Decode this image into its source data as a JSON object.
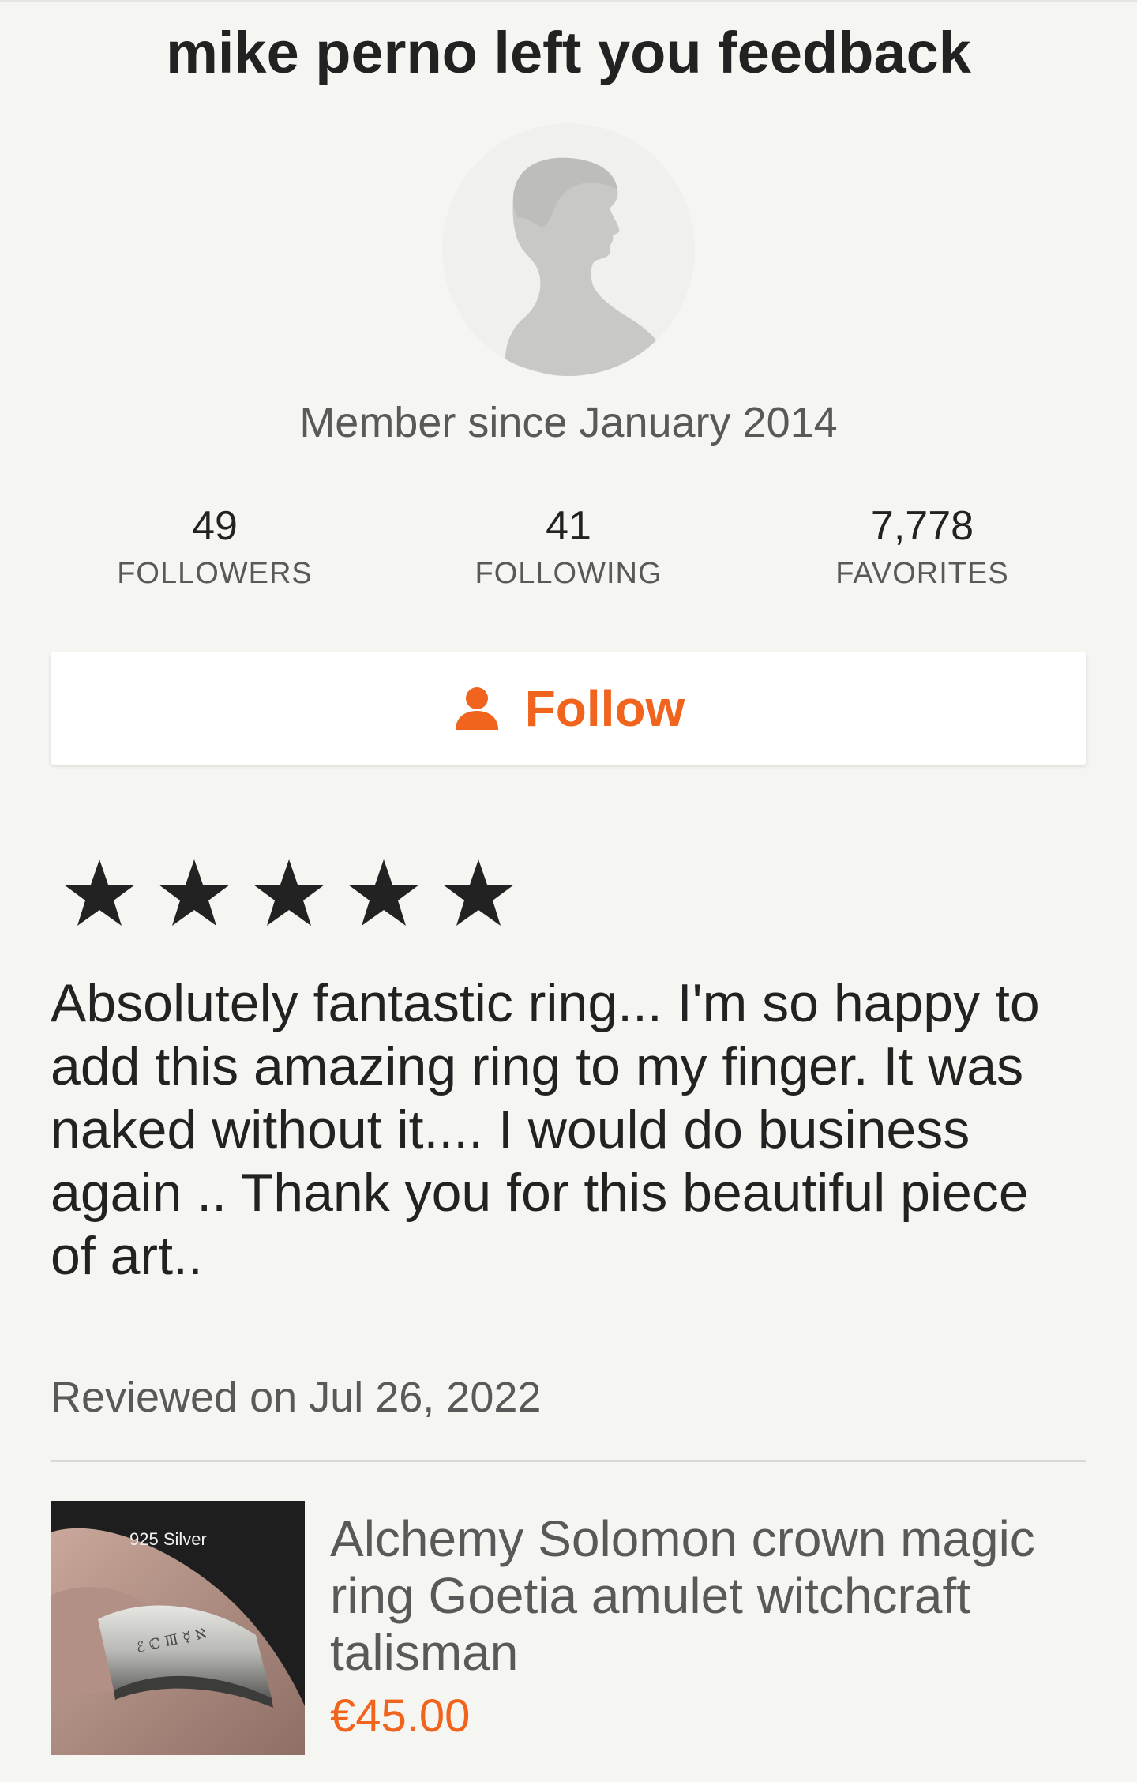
{
  "header": {
    "title": "mike perno left you feedback"
  },
  "profile": {
    "member_since": "Member since January 2014",
    "stats": [
      {
        "value": "49",
        "label": "FOLLOWERS"
      },
      {
        "value": "41",
        "label": "FOLLOWING"
      },
      {
        "value": "7,778",
        "label": "FAVORITES"
      }
    ],
    "follow_label": "Follow"
  },
  "review": {
    "rating": 5,
    "rating_max": 5,
    "text": "Absolutely fantastic ring... I'm so happy to add this amazing ring to my finger. It was naked without it....  I would do business again .. Thank you for this beautiful piece of art..",
    "reviewed_on": "Reviewed on Jul 26, 2022"
  },
  "listing": {
    "image_overlay_text": "925 Silver",
    "title": "Alchemy Solomon crown magic ring Goetia amulet witchcraft talisman",
    "price": "€45.00"
  },
  "colors": {
    "accent": "#f1641e",
    "background": "#f5f5f1",
    "text_primary": "#222222",
    "text_secondary": "#595959"
  }
}
